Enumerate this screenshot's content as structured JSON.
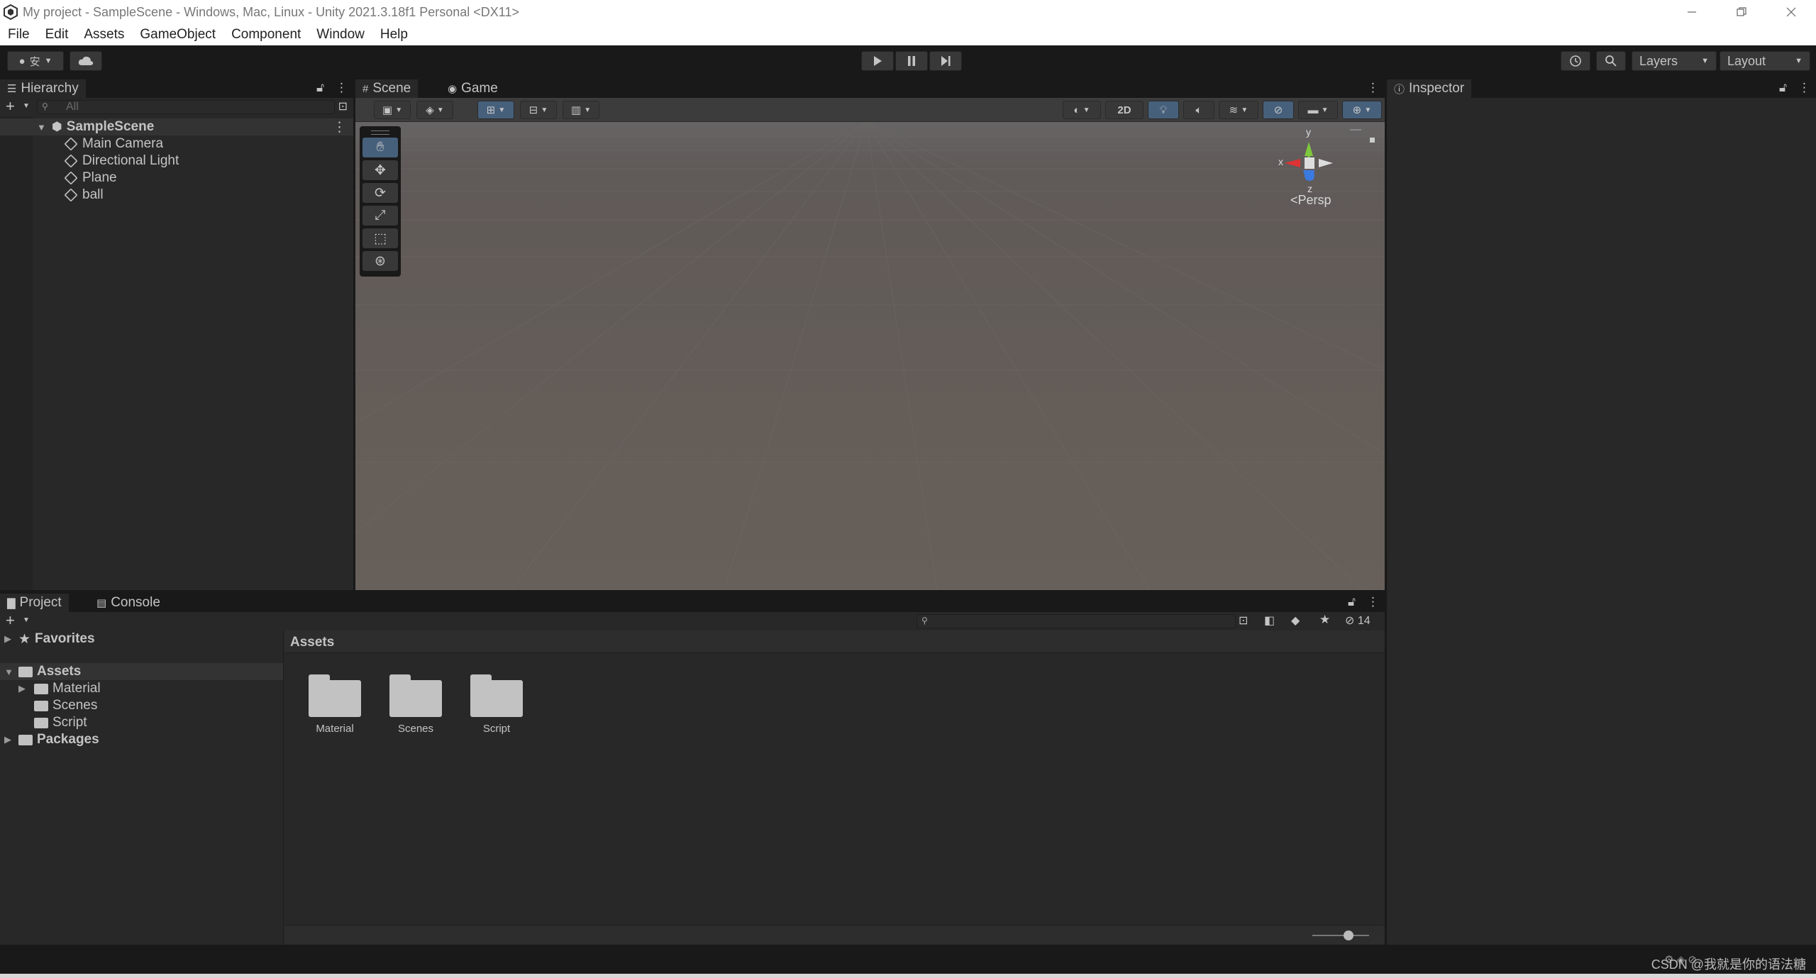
{
  "window": {
    "title": "My project - SampleScene - Windows, Mac, Linux - Unity 2021.3.18f1 Personal <DX11>",
    "controls": [
      "minimize-icon",
      "restore-icon",
      "close-icon"
    ]
  },
  "menu": {
    "items": [
      "File",
      "Edit",
      "Assets",
      "GameObject",
      "Component",
      "Window",
      "Help"
    ]
  },
  "toolbar": {
    "account_label": "安",
    "layers_label": "Layers",
    "layout_label": "Layout",
    "play_icon": "play-icon",
    "pause_icon": "pause-icon",
    "step_icon": "step-icon"
  },
  "hierarchy": {
    "tab_label": "Hierarchy",
    "search_placeholder": "All",
    "scene_name": "SampleScene",
    "objects": [
      "Main Camera",
      "Directional Light",
      "Plane",
      "ball"
    ]
  },
  "scene": {
    "tabs": [
      "Scene",
      "Game"
    ],
    "toggle_2d": "2D",
    "gizmo": {
      "y": "y",
      "x": "x",
      "z": "z",
      "persp": "Persp"
    },
    "tools": [
      "hand-icon",
      "move-icon",
      "rotate-icon",
      "scale-icon",
      "rect-icon",
      "transform-icon"
    ]
  },
  "inspector": {
    "tab_label": "Inspector"
  },
  "project": {
    "tabs": [
      "Project",
      "Console"
    ],
    "favorites": "Favorites",
    "assets": "Assets",
    "asset_children": [
      "Material",
      "Scenes",
      "Script"
    ],
    "packages": "Packages",
    "breadcrumb": "Assets",
    "folders": [
      "Material",
      "Scenes",
      "Script"
    ],
    "hidden_count": "14"
  },
  "status": {
    "watermark": "CSDN @我就是你的语法糖️"
  },
  "colors": {
    "background": "#191919",
    "panel": "#282828",
    "accent": "#46607c",
    "viewport": "#635c58"
  }
}
